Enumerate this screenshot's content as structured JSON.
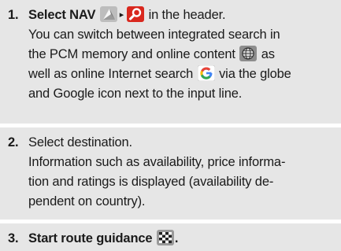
{
  "steps": [
    {
      "number": "1.",
      "lead": "Select ",
      "nav_label": "NAV",
      "arrow": "▸",
      "after_icons": " in the header.",
      "line2": "You can switch between integrated search in",
      "line3_pre": "the PCM memory and online content ",
      "line3_post": " as",
      "line4_pre": "well as online Internet search ",
      "line4_post": " via the globe",
      "line5": "and Google icon next to the input line."
    },
    {
      "number": "2.",
      "title": "Select destination.",
      "line2": "Information such as availability, price informa-",
      "line3": "tion and ratings is displayed (availability de-",
      "line4": "pendent on country)."
    },
    {
      "number": "3.",
      "title": "Start route guidance",
      "title_end": "."
    }
  ],
  "icons": {
    "nav": "navigation-arrow-icon",
    "search": "search-icon",
    "globe": "globe-icon",
    "google": "google-icon",
    "flag": "checkered-flag-icon"
  },
  "colors": {
    "panel_bg": "#e6e6e6",
    "text": "#1a1a1a",
    "search_red": "#d9281e"
  }
}
